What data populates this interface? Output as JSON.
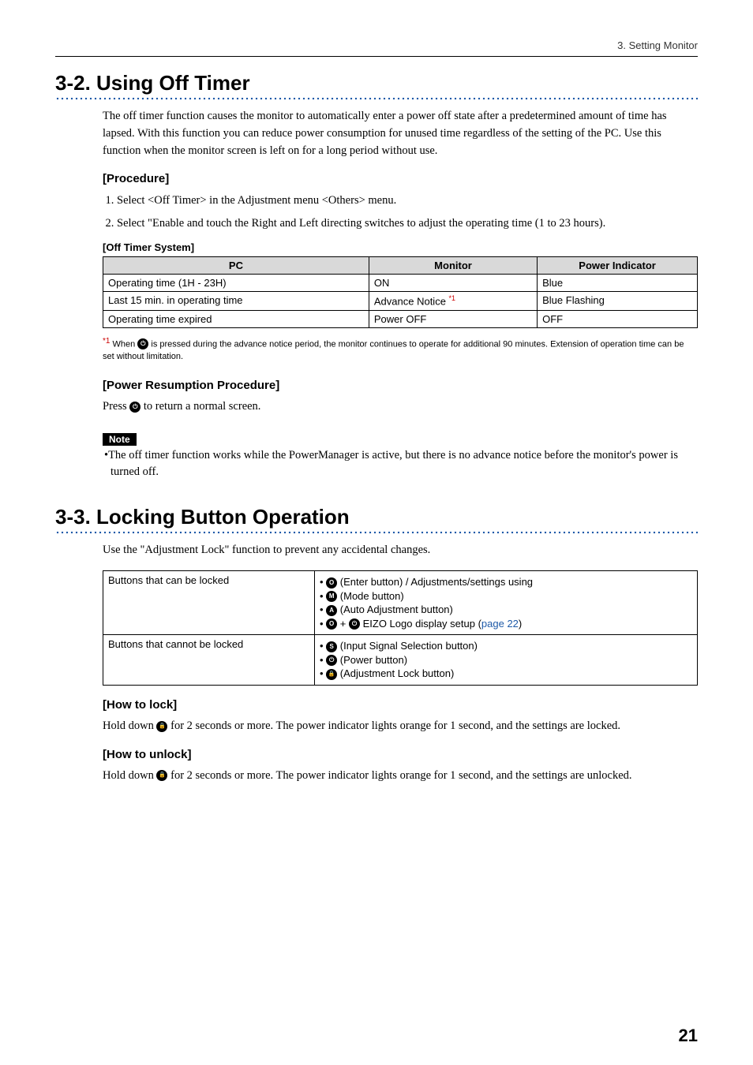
{
  "header": {
    "breadcrumb": "3. Setting Monitor"
  },
  "section32": {
    "title": "3-2. Using Off Timer",
    "intro": "The off timer function causes the monitor to automatically enter a power off state after a predetermined amount of time has lapsed. With this function you can reduce power consumption for unused time regardless of the setting of the PC. Use this function when the monitor screen is left on for a long period without use.",
    "procedure_heading": "[Procedure]",
    "procedure_items": [
      "Select <Off Timer> in the Adjustment menu <Others> menu.",
      "Select \"Enable and touch the Right and Left directing switches to adjust the operating time (1 to 23 hours)."
    ],
    "off_timer_heading": "[Off Timer System]",
    "table_headers": [
      "PC",
      "Monitor",
      "Power Indicator"
    ],
    "table_rows": [
      [
        "Operating time (1H - 23H)",
        "ON",
        "Blue"
      ],
      [
        "Last 15 min. in operating time",
        "Advance Notice ",
        "Blue Flashing"
      ],
      [
        "Operating time expired",
        "Power OFF",
        "OFF"
      ]
    ],
    "footnote_sup": "*1",
    "footnote_text": " is pressed during the advance notice period, the monitor continues to operate for additional 90 minutes. Extension of operation time can be set without limitation.",
    "footnote_prefix": "When ",
    "power_resume_heading": "[Power Resumption Procedure]",
    "power_resume_pre": "Press ",
    "power_resume_post": " to return a normal screen.",
    "note_label": "Note",
    "note_text": "•The off timer function works while the PowerManager is active, but there is no advance notice before the monitor's power is turned off."
  },
  "section33": {
    "title": "3-3. Locking Button Operation",
    "intro": "Use the \"Adjustment Lock\" function to prevent any accidental changes.",
    "row1_label": "Buttons that can be locked",
    "row1_items": {
      "enter": " (Enter button) / Adjustments/settings using",
      "mode": " (Mode button)",
      "auto": " (Auto Adjustment button)",
      "logo_pre": " + ",
      "logo_post": " EIZO Logo display setup (",
      "logo_link": "page 22",
      "logo_close": ")"
    },
    "row2_label": "Buttons that cannot be locked",
    "row2_items": {
      "signal": " (Input Signal Selection button)",
      "power": " (Power button)",
      "lock": " (Adjustment Lock button)"
    },
    "how_lock_heading": "[How to lock]",
    "how_lock_pre": "Hold down ",
    "how_lock_post": " for 2 seconds or more. The power indicator lights orange for 1 second, and the settings are locked.",
    "how_unlock_heading": "[How to unlock]",
    "how_unlock_pre": "Hold down ",
    "how_unlock_post": " for 2 seconds or more. The power indicator lights orange for 1 second, and the settings are unlocked."
  },
  "icons": {
    "power": "⏻",
    "enter": "O",
    "mode": "M",
    "auto": "A",
    "signal": "S",
    "lock": "🔒"
  },
  "page_number": "21"
}
